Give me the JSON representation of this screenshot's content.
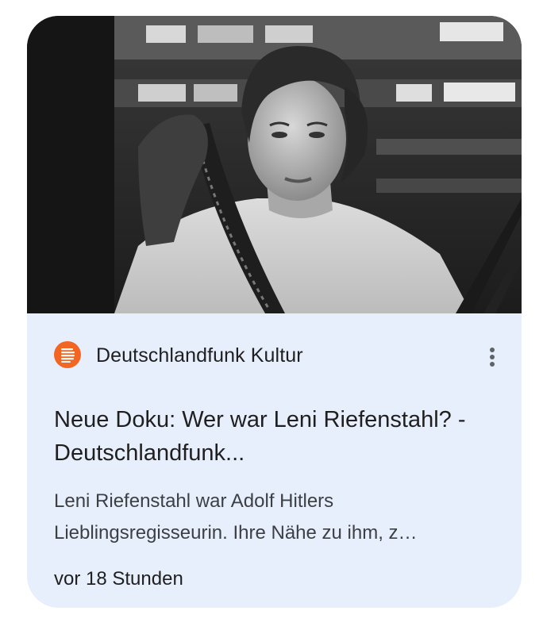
{
  "card": {
    "image_alt": "Schwarzweißfoto: Leni Riefenstahl betrachtet einen Filmstreifen",
    "source": {
      "name": "Deutschlandfunk Kultur",
      "logo_color": "#f26522"
    },
    "menu_icon": "more-vert-icon",
    "headline": "Neue Doku: Wer war Leni Riefenstahl? - Deutschlandfunk...",
    "snippet": "Leni Riefenstahl war Adolf Hitlers Lieblingsregisseurin. Ihre Nähe zu ihm, z…",
    "timestamp": "vor 18 Stunden"
  },
  "colors": {
    "card_background": "#e8effc",
    "text_primary": "#1f1f1f",
    "text_secondary": "#3c3f44"
  }
}
